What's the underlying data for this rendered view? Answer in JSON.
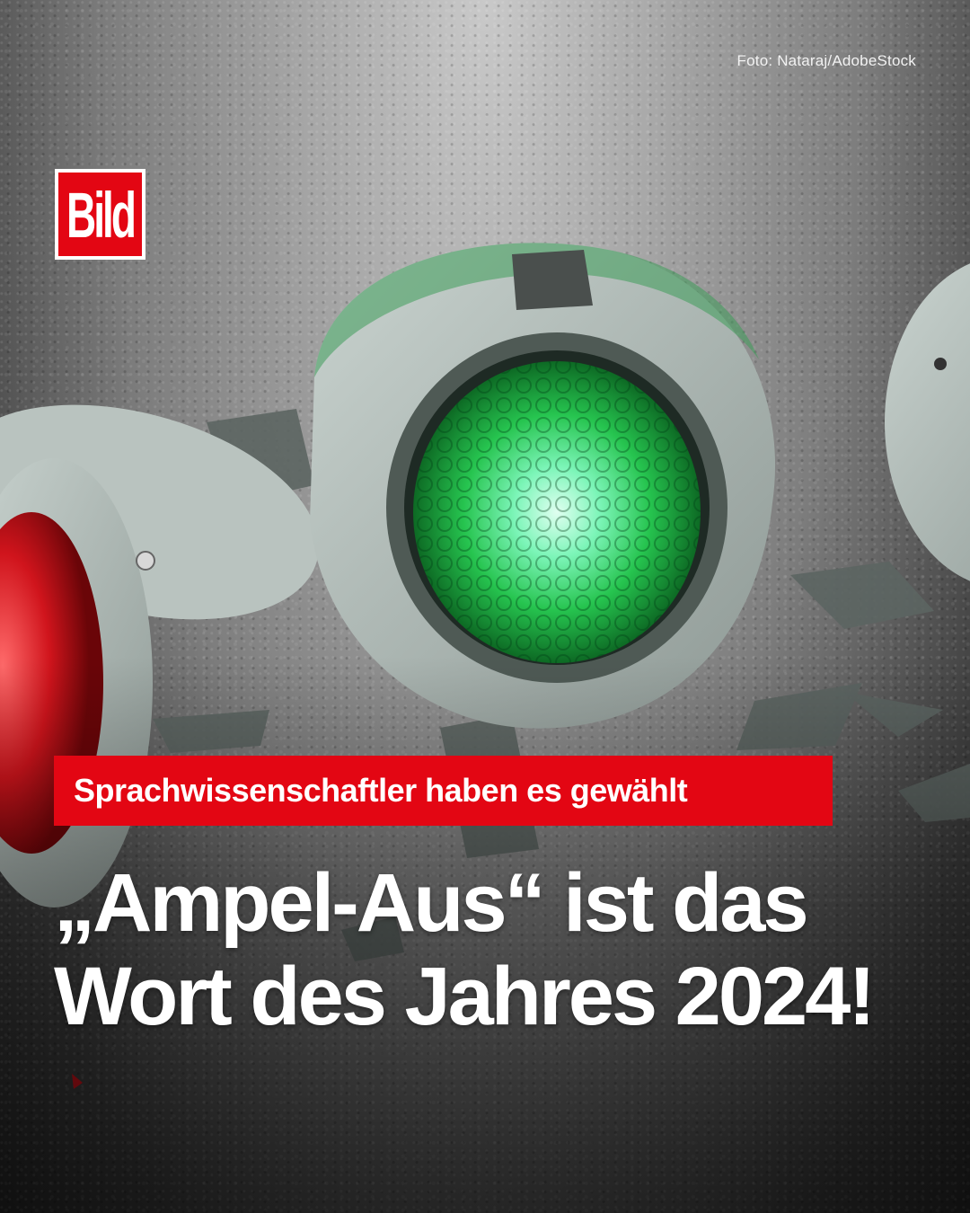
{
  "photo_credit": "Foto: Nataraj/AdobeStock",
  "logo": {
    "text": "Bild",
    "color": "#e30613"
  },
  "kicker": {
    "text": "Sprachwissenschaftler haben es gewählt",
    "background": "#e30613"
  },
  "headline": {
    "line1": "„Ampel-Aus“ ist das",
    "line2": "Wort des Jahres 2024!"
  }
}
